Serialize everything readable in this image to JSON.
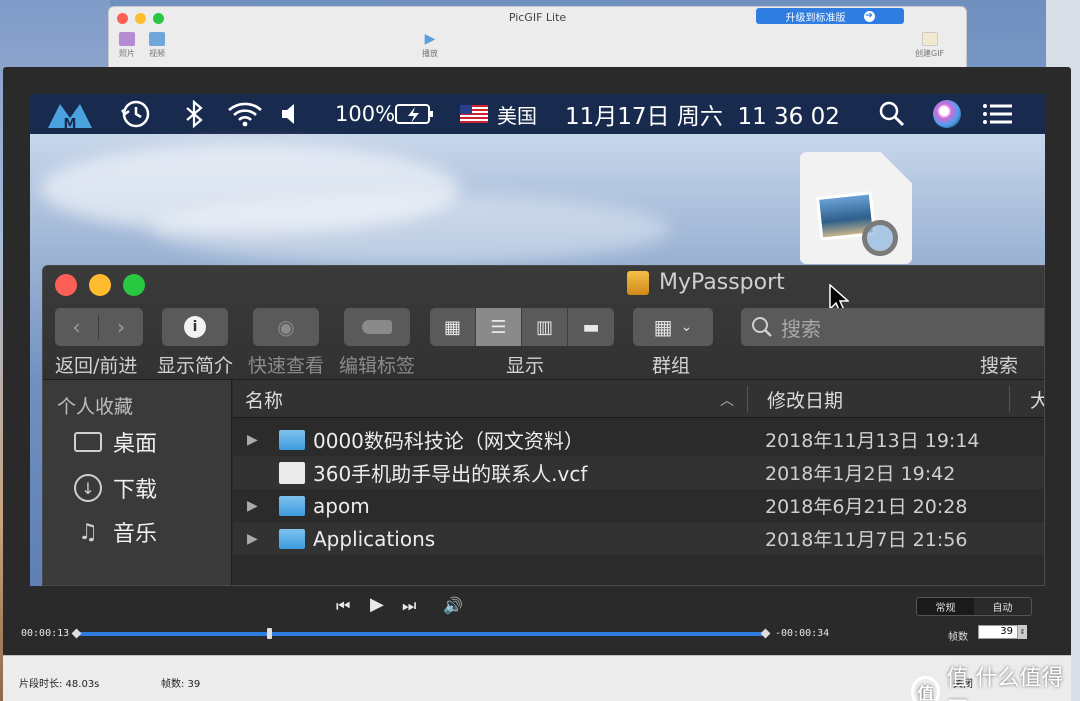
{
  "picgif": {
    "title": "PicGIF Lite",
    "upgrade_label": "升级到标准版",
    "tools": [
      {
        "label": "照片",
        "icon": "photo-icon"
      },
      {
        "label": "视频",
        "icon": "video-icon"
      },
      {
        "label": "播放",
        "icon": "play-icon"
      },
      {
        "label": "创建GIF",
        "icon": "create-gif-icon"
      }
    ]
  },
  "menubar": {
    "battery": "100%",
    "input_source": "美国",
    "clock": "11月17日 周六  11 36 02"
  },
  "finder": {
    "title": "MyPassport",
    "toolbar": {
      "nav_label": "返回/前进",
      "info_label": "显示简介",
      "quicklook_label": "快速查看",
      "tags_label": "编辑标签",
      "view_label": "显示",
      "group_label": "群组",
      "search_placeholder": "搜索",
      "search_label": "搜索"
    },
    "sidebar": {
      "heading": "个人收藏",
      "items": [
        {
          "label": "桌面",
          "icon": "desktop-icon"
        },
        {
          "label": "下载",
          "icon": "download-icon"
        },
        {
          "label": "音乐",
          "icon": "music-icon"
        }
      ]
    },
    "columns": {
      "name": "名称",
      "modified": "修改日期",
      "size": "大"
    },
    "rows": [
      {
        "name": "0000数码科技论（网文资料）",
        "date": "2018年11月13日 19:14",
        "type": "folder"
      },
      {
        "name": "360手机助手导出的联系人.vcf",
        "date": "2018年1月2日 19:42",
        "type": "vcf"
      },
      {
        "name": "apom",
        "date": "2018年6月21日 20:28",
        "type": "folder"
      },
      {
        "name": "Applications",
        "date": "2018年11月7日 21:56",
        "type": "folder"
      }
    ]
  },
  "player": {
    "time_current": "00:00:13",
    "time_remaining": "-00:00:34",
    "progress_fraction": 0.28,
    "mode_normal": "常规",
    "mode_auto": "自动",
    "fps_label": "帧数",
    "fps_value": "39"
  },
  "status": {
    "duration": "片段时长: 48.03s",
    "frames": "帧数: 39",
    "close_label": "关闭"
  },
  "watermark": {
    "text": "值 什么值得买",
    "logo": "值"
  },
  "colors": {
    "accent": "#2f7de1",
    "menubar": "#182a4d",
    "finder_bg": "#2b2b2b"
  }
}
